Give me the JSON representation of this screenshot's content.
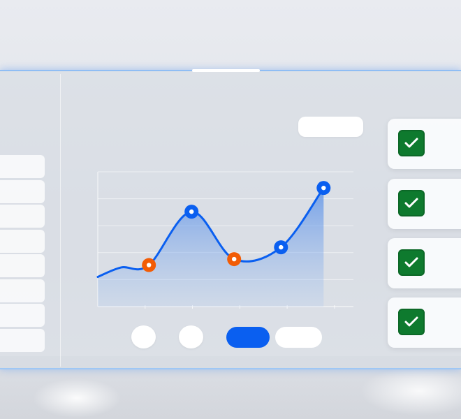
{
  "app": {
    "accent_color": "#0a5ff0",
    "highlight_color": "#f25c05",
    "success_color": "#0e7a2e"
  },
  "left_list": {
    "row_count": 8
  },
  "filters": {
    "options": [
      {
        "icon": "blank-circle",
        "active": false
      },
      {
        "icon": "blank-circle",
        "active": false
      },
      {
        "icon": "blank-pill",
        "active": true
      },
      {
        "icon": "blank-pill",
        "active": false
      }
    ]
  },
  "tasks": [
    {
      "icon": "checkmark-icon",
      "checked": true
    },
    {
      "icon": "checkmark-icon",
      "checked": true
    },
    {
      "icon": "checkmark-icon",
      "checked": true
    },
    {
      "icon": "checkmark-icon",
      "checked": true
    }
  ],
  "chart_data": {
    "type": "line",
    "x": [
      0,
      1,
      2,
      3,
      4,
      5,
      6
    ],
    "y": [
      25,
      35,
      80,
      40,
      50,
      100,
      100
    ],
    "point_markers": [
      {
        "x": 1.2,
        "y": 35,
        "color": "#f25c05"
      },
      {
        "x": 2.2,
        "y": 80,
        "color": "#0a5ff0"
      },
      {
        "x": 3.2,
        "y": 40,
        "color": "#f25c05"
      },
      {
        "x": 4.3,
        "y": 50,
        "color": "#0a5ff0"
      },
      {
        "x": 5.3,
        "y": 100,
        "color": "#0a5ff0"
      }
    ],
    "ylim": [
      0,
      100
    ],
    "grid": true,
    "area_fill": true,
    "line_color": "#0a5ff0",
    "title": "",
    "xlabel": "",
    "ylabel": ""
  }
}
